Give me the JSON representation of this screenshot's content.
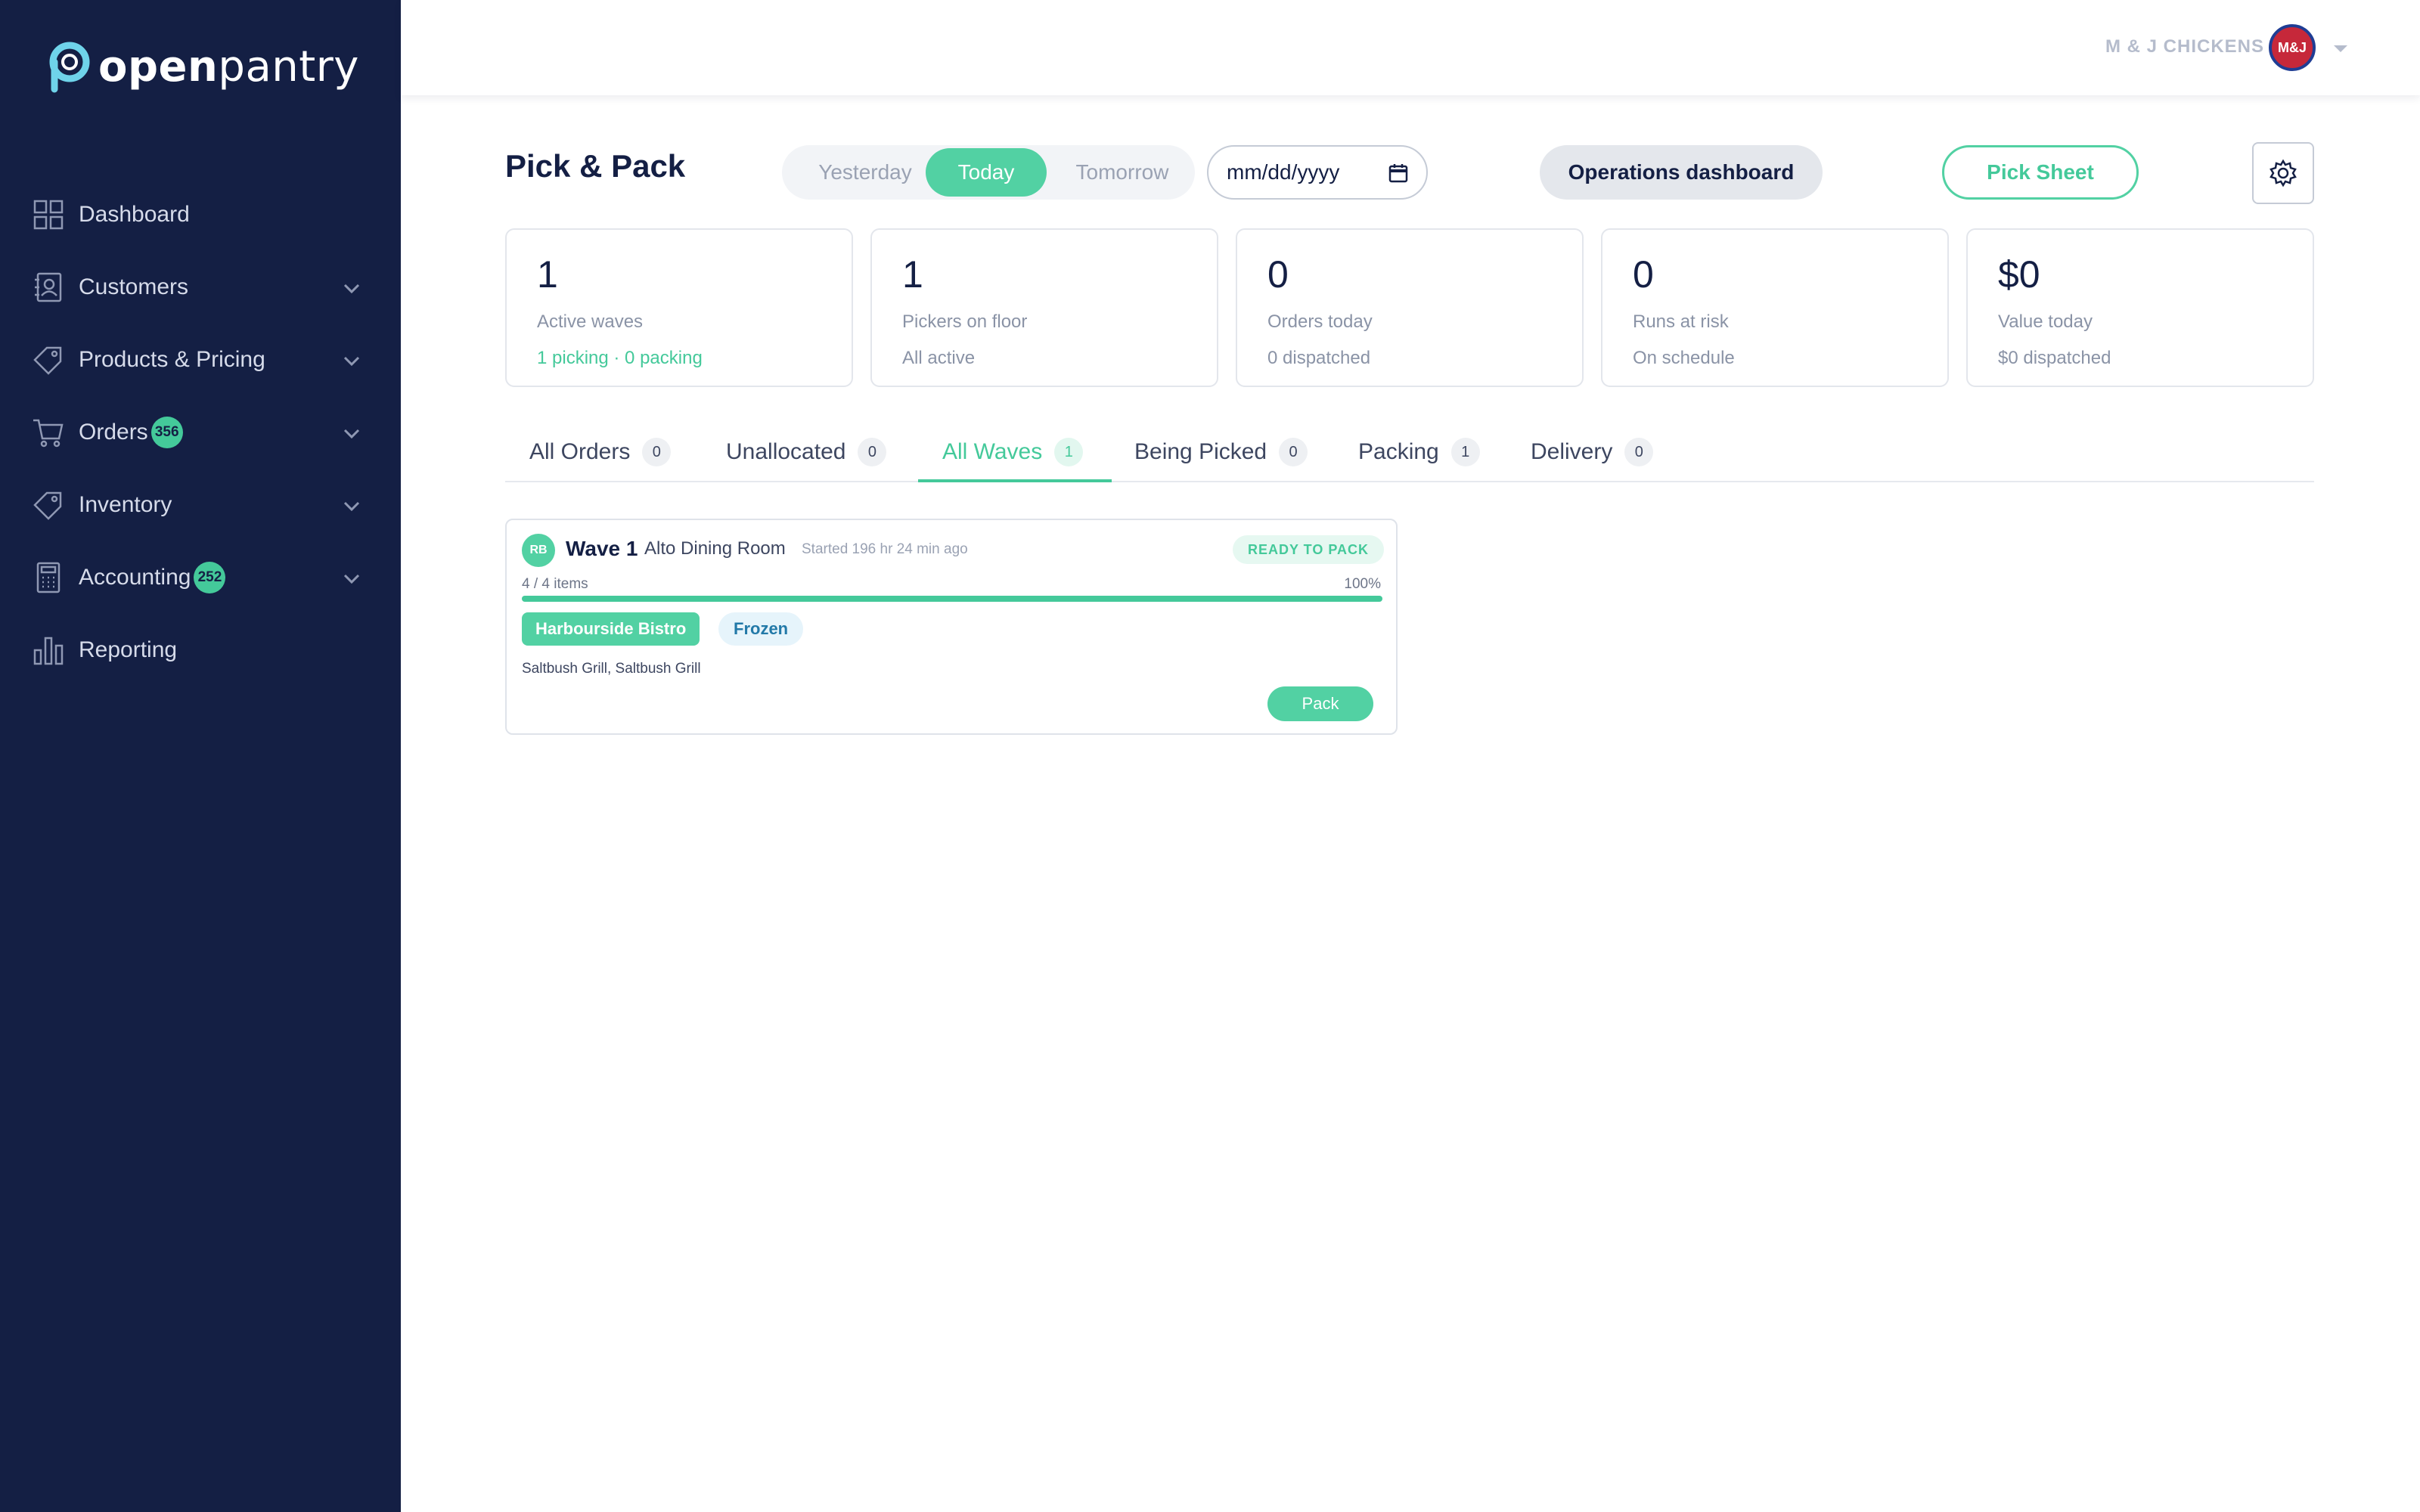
{
  "brand": {
    "name_bold": "open",
    "name_light": "pantry"
  },
  "sidebar": {
    "items": [
      {
        "label": "Dashboard",
        "icon": "grid-icon",
        "has_chevron": false
      },
      {
        "label": "Customers",
        "icon": "contacts-icon",
        "has_chevron": true
      },
      {
        "label": "Products & Pricing",
        "icon": "tag-icon",
        "has_chevron": true
      },
      {
        "label": "Orders",
        "icon": "cart-icon",
        "has_chevron": true,
        "badge": "356"
      },
      {
        "label": "Inventory",
        "icon": "tag-icon",
        "has_chevron": true
      },
      {
        "label": "Accounting",
        "icon": "calculator-icon",
        "has_chevron": true,
        "badge": "252"
      },
      {
        "label": "Reporting",
        "icon": "bar-chart-icon",
        "has_chevron": false
      }
    ]
  },
  "header": {
    "org_name": "M & J CHICKENS",
    "avatar_text": "M&J"
  },
  "page": {
    "title": "Pick & Pack",
    "day_toggle": {
      "yesterday": "Yesterday",
      "today": "Today",
      "tomorrow": "Tomorrow",
      "selected": "Today"
    },
    "date_placeholder": "mm/dd/yyyy",
    "ops_button": "Operations dashboard",
    "pick_sheet_button": "Pick Sheet"
  },
  "stats": [
    {
      "value": "1",
      "label": "Active waves",
      "sub": "1 picking · 0 packing",
      "sub_green": true
    },
    {
      "value": "1",
      "label": "Pickers on floor",
      "sub": "All active",
      "sub_green": false
    },
    {
      "value": "0",
      "label": "Orders today",
      "sub": "0 dispatched",
      "sub_green": false
    },
    {
      "value": "0",
      "label": "Runs at risk",
      "sub": "On schedule",
      "sub_green": false
    },
    {
      "value": "$0",
      "label": "Value today",
      "sub": "$0 dispatched",
      "sub_green": false
    }
  ],
  "tabs": [
    {
      "label": "All Orders",
      "count": "0"
    },
    {
      "label": "Unallocated",
      "count": "0"
    },
    {
      "label": "All Waves",
      "count": "1",
      "active": true
    },
    {
      "label": "Being Picked",
      "count": "0"
    },
    {
      "label": "Packing",
      "count": "1"
    },
    {
      "label": "Delivery",
      "count": "0"
    }
  ],
  "wave": {
    "picker_initials": "RB",
    "title": "Wave 1",
    "customer": "Alto Dining Room",
    "started": "Started 196 hr 24 min ago",
    "status": "READY TO PACK",
    "items": "4 / 4 items",
    "percent_label": "100%",
    "progress": 1.0,
    "venue_tag": "Harbourside Bistro",
    "temp_tag": "Frozen",
    "note": "Saltbush Grill, Saltbush Grill",
    "action": "Pack"
  },
  "colors": {
    "sidebar_bg": "#141f44",
    "accent": "#44c99a",
    "accent_light": "#52d1a3"
  }
}
